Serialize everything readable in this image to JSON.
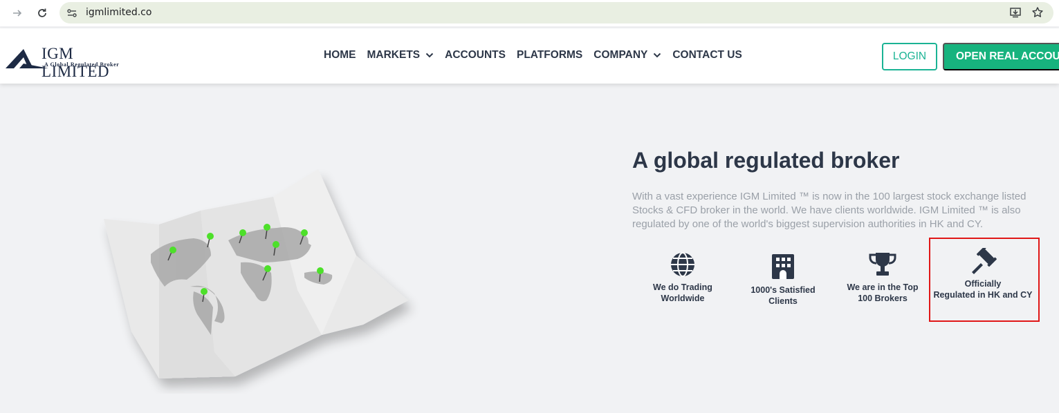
{
  "browser": {
    "url": "igmlimited.co"
  },
  "header": {
    "logo_name": "IGM LIMITED",
    "logo_tagline": "A Global Regulated Broker",
    "nav": [
      {
        "label": "HOME"
      },
      {
        "label": "MARKETS"
      },
      {
        "label": "ACCOUNTS"
      },
      {
        "label": "PLATFORMS"
      },
      {
        "label": "COMPANY"
      },
      {
        "label": "CONTACT US"
      }
    ],
    "login_label": "LOGIN",
    "open_account_label": "OPEN REAL ACCOUNT"
  },
  "hero": {
    "title": "A global regulated broker",
    "description": "With a vast experience IGM Limited ™ is now in the 100 largest stock exchange listed Stocks & CFD broker in the world. We have clients worldwide. IGM Limited ™ is also regulated by one of the world's biggest supervision authorities in HK and CY.",
    "features": [
      {
        "icon": "globe-icon",
        "line1": "We do Trading",
        "line2": "Worldwide"
      },
      {
        "icon": "building-icon",
        "line1": "1000's Satisfied",
        "line2": "Clients"
      },
      {
        "icon": "trophy-icon",
        "line1": "We are in the Top",
        "line2": "100 Brokers"
      },
      {
        "icon": "gavel-icon",
        "line1": "Officially",
        "line2": "Regulated in HK and CY"
      }
    ]
  },
  "colors": {
    "accent_green": "#17b37e",
    "login_border": "#1ab394",
    "highlight_red": "#e01616",
    "text_dark": "#2d3748"
  }
}
